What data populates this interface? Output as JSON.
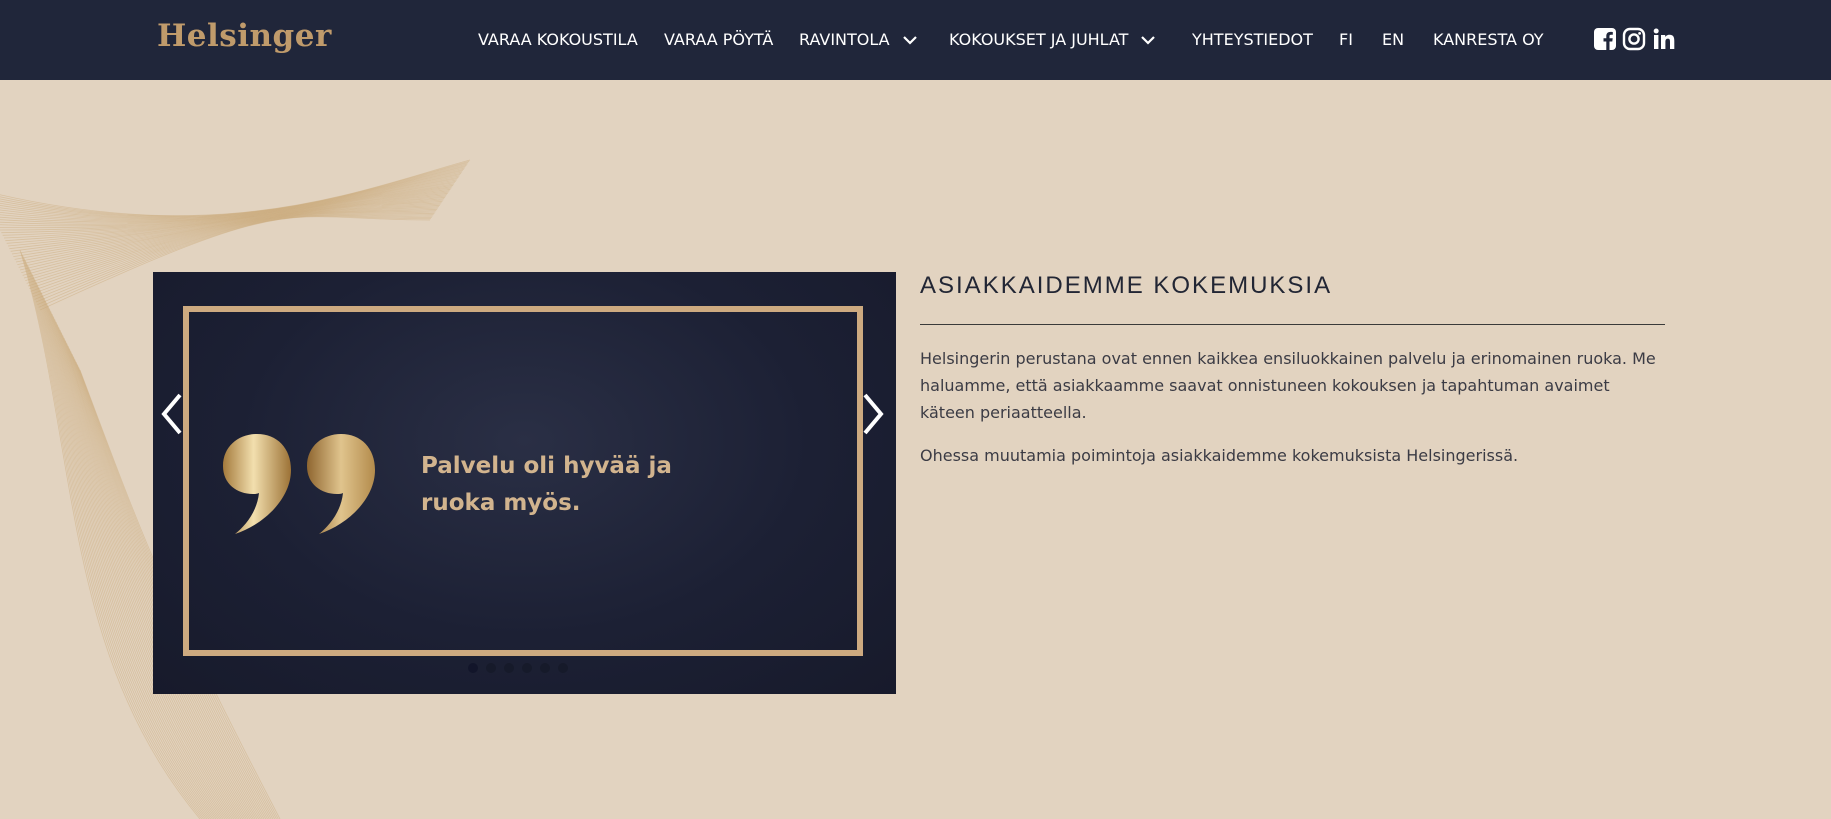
{
  "header": {
    "logo": "Helsinger",
    "nav": [
      {
        "label": "VARAA KOKOUSTILA"
      },
      {
        "label": "VARAA PÖYTÄ"
      },
      {
        "label": "RAVINTOLA"
      },
      {
        "label": "KOKOUKSET JA JUHLAT"
      },
      {
        "label": "YHTEYSTIEDOT"
      },
      {
        "label": "FI"
      },
      {
        "label": "EN"
      },
      {
        "label": "KANRESTA OY"
      }
    ],
    "social": [
      "facebook-icon",
      "instagram-icon",
      "linkedin-icon"
    ]
  },
  "slider": {
    "quote": "Palvelu oli hyvää ja ruoka myös.",
    "dots": 6,
    "active_dot": 0
  },
  "main": {
    "title": "ASIAKKAIDEMME KOKEMUKSIA",
    "paragraph1": "Helsingerin perustana ovat ennen kaikkea ensiluokkainen palvelu ja erinomainen ruoka. Me haluamme, että asiakkaamme saavat onnistuneen kokouksen ja tapahtuman avaimet käteen periaatteella.",
    "paragraph2": "Ohessa muutamia poimintoja asiakkaidemme kokemuksista Helsingerissä."
  },
  "colors": {
    "header_bg": "#20263a",
    "page_bg": "#e2d3c0",
    "gold": "#cdaa80",
    "slider_bg": "#1c2034"
  }
}
